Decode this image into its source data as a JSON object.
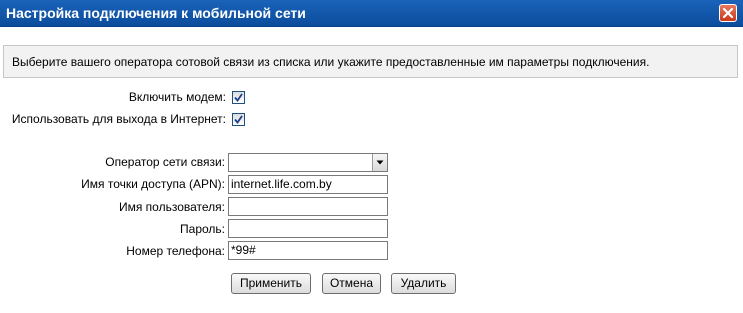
{
  "window": {
    "title": "Настройка подключения к мобильной сети",
    "close_icon": "close-icon"
  },
  "info": {
    "text": "Выберите вашего оператора сотовой связи из списка или укажите предоставленные им параметры подключения."
  },
  "form": {
    "enable_modem": {
      "label": "Включить модем:",
      "checked": true
    },
    "use_for_internet": {
      "label": "Использовать для выхода в Интернет:",
      "checked": true
    },
    "operator": {
      "label": "Оператор сети связи:",
      "value": ""
    },
    "apn": {
      "label": "Имя точки доступа (APN):",
      "value": "internet.life.com.by"
    },
    "username": {
      "label": "Имя пользователя:",
      "value": ""
    },
    "password": {
      "label": "Пароль:",
      "value": ""
    },
    "phone": {
      "label": "Номер телефона:",
      "value": "*99#"
    }
  },
  "buttons": {
    "apply": "Применить",
    "cancel": "Отмена",
    "delete": "Удалить"
  },
  "colors": {
    "titlebar": "#1a63b9",
    "close_button": "#c8371a",
    "info_background": "#f2f2f2"
  }
}
